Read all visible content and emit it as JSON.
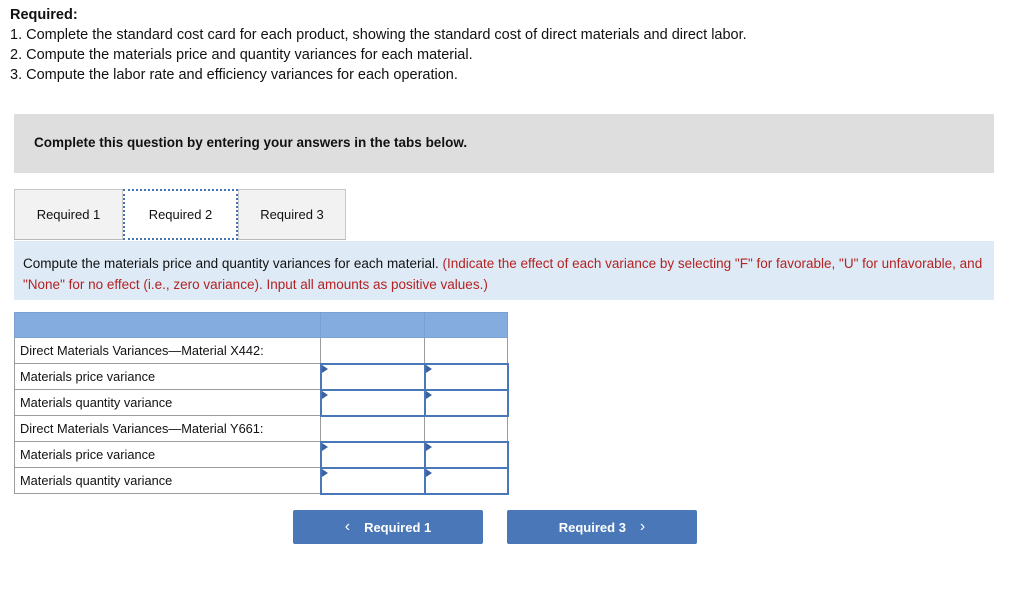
{
  "required": {
    "title": "Required:",
    "items": [
      "1. Complete the standard cost card for each product, showing the standard cost of direct materials and direct labor.",
      "2. Compute the materials price and quantity variances for each material.",
      "3. Compute the labor rate and efficiency variances for each operation."
    ]
  },
  "banner": {
    "text": "Complete this question by entering your answers in the tabs below."
  },
  "tabs": [
    {
      "label": "Required 1",
      "active": false
    },
    {
      "label": "Required 2",
      "active": true
    },
    {
      "label": "Required 3",
      "active": false
    }
  ],
  "instruction": {
    "black_part": "Compute the materials price and quantity variances for each material.",
    "red_part": "(Indicate the effect of each variance by selecting \"F\" for favorable, \"U\" for unfavorable, and \"None\" for no effect (i.e., zero variance). Input all amounts as positive values.)"
  },
  "table": {
    "headers": [
      "",
      "",
      ""
    ],
    "rows": [
      {
        "label": "Direct Materials Variances—Material X442:",
        "amount": "",
        "effect": "",
        "editable": false
      },
      {
        "label": "Materials price variance",
        "amount": "",
        "effect": "",
        "editable": true
      },
      {
        "label": "Materials quantity variance",
        "amount": "",
        "effect": "",
        "editable": true
      },
      {
        "label": "Direct Materials Variances—Material Y661:",
        "amount": "",
        "effect": "",
        "editable": false
      },
      {
        "label": "Materials price variance",
        "amount": "",
        "effect": "",
        "editable": true
      },
      {
        "label": "Materials quantity variance",
        "amount": "",
        "effect": "",
        "editable": true
      }
    ]
  },
  "nav": {
    "prev_label": "Required 1",
    "prev_icon": "chevron-left",
    "prev_glyph": "‹",
    "next_label": "Required 3",
    "next_icon": "chevron-right",
    "next_glyph": "›"
  },
  "colors": {
    "button_blue": "#4a77b8",
    "table_header_blue": "#85acde",
    "instruction_bg": "#deebf7",
    "banner_gray": "#dedede",
    "red_text": "#b42222",
    "input_border": "#4a77b8"
  }
}
